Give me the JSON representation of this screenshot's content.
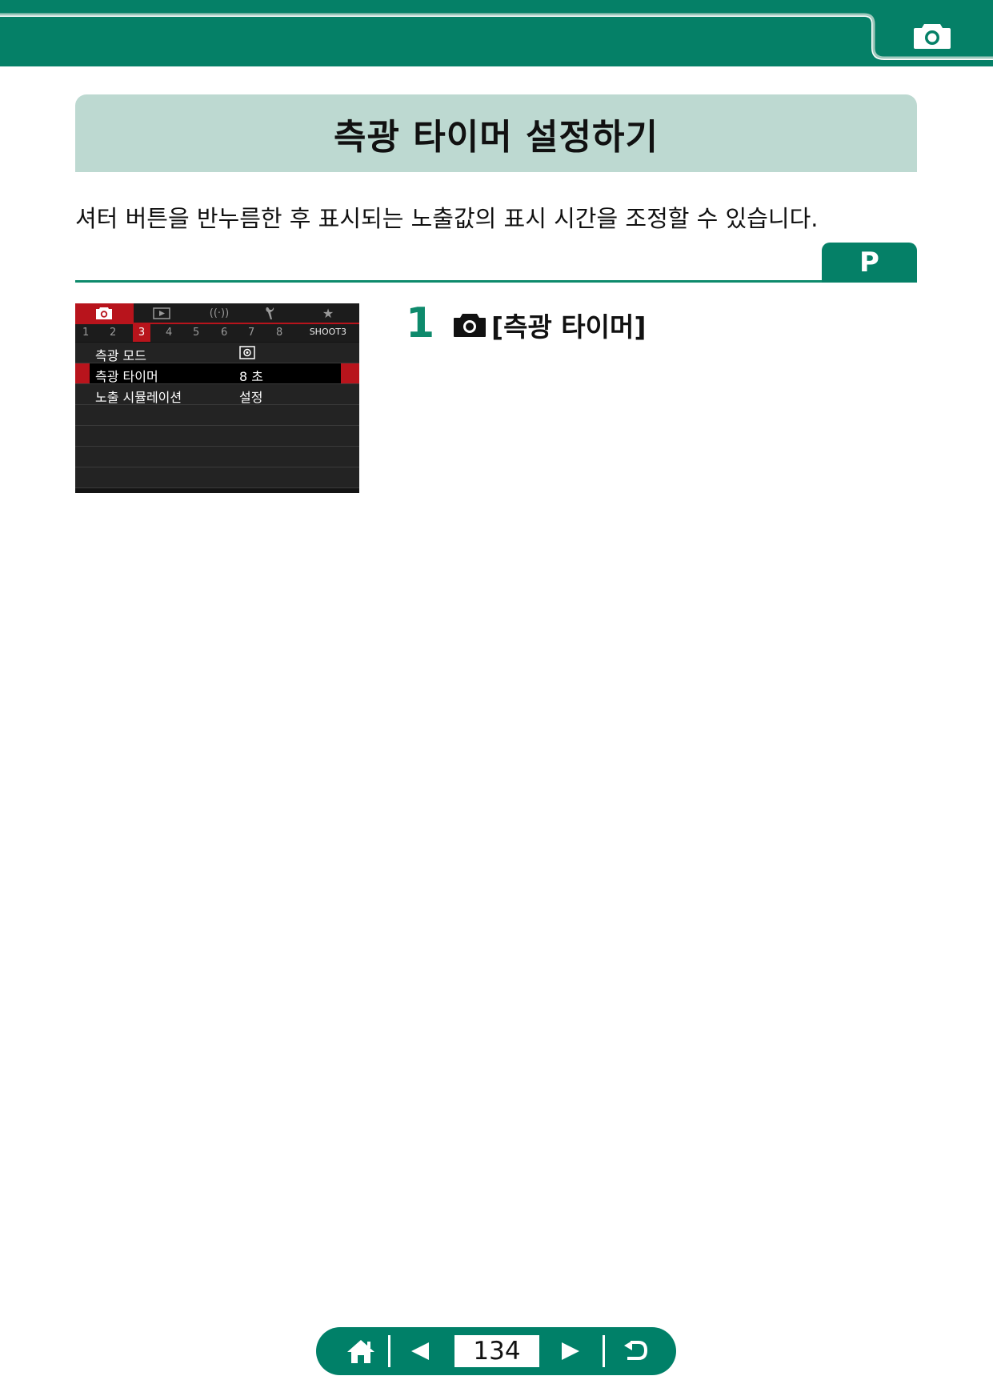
{
  "header": {
    "tab_icon": "camera-icon",
    "accent_color": "#058067"
  },
  "title": "측광 타이머 설정하기",
  "intro": "셔터 버튼을 반누름한 후 표시되는 노출값의 표시 시간을 조정할 수 있습니다.",
  "mode_badge": "P",
  "camera_screen": {
    "tab_icons": [
      "camera-icon",
      "playback-icon",
      "wireless-icon",
      "wrench-icon",
      "star-icon"
    ],
    "page_numbers": [
      "1",
      "2",
      "3",
      "4",
      "5",
      "6",
      "7",
      "8"
    ],
    "active_page": "3",
    "menu_title": "SHOOT3",
    "rows": [
      {
        "label": "측광 모드",
        "value": "◙",
        "selected": false
      },
      {
        "label": "측광 타이머",
        "value": "8 초",
        "selected": true
      },
      {
        "label": "노출 시뮬레이션",
        "value": "설정",
        "selected": false
      }
    ]
  },
  "step": {
    "number": "1",
    "icon": "camera-icon",
    "text": "[측광 타이머]"
  },
  "nav": {
    "home_icon": "home-icon",
    "prev_icon": "prev-arrow-icon",
    "page": "134",
    "next_icon": "next-arrow-icon",
    "back_icon": "return-icon"
  }
}
